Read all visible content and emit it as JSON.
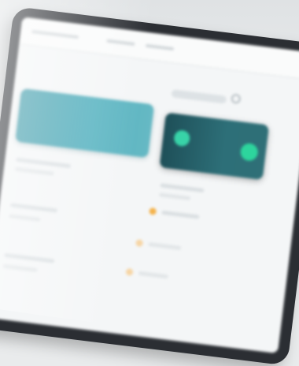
{
  "colors": {
    "background": "#e9ebec",
    "device_frame": "#2b2e33",
    "screen": "#f4f6f7",
    "primary_card": "#4aa8b6",
    "secondary_card": "#23575f",
    "indicator_green": "#33d4a2",
    "accent_orange": "#f4b24a"
  },
  "icons": {
    "search": "search-icon",
    "status_left": "status-dot-icon",
    "status_right": "status-dot-icon",
    "list_marker": "dot-icon"
  }
}
